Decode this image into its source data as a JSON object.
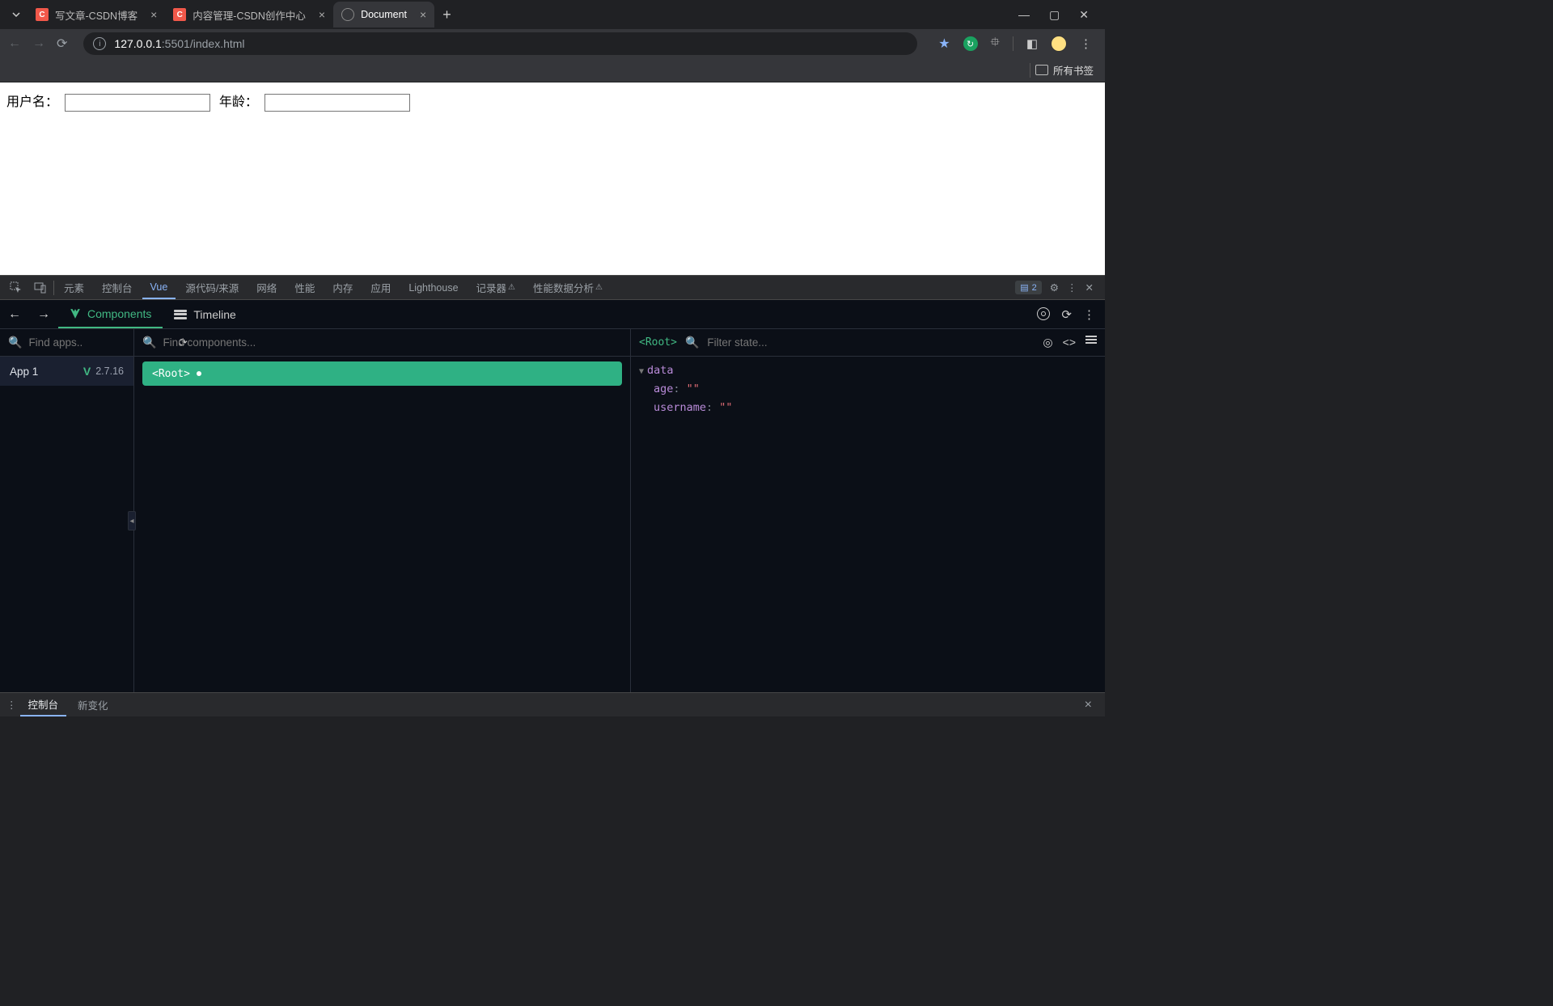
{
  "browser": {
    "tabs": [
      {
        "title": "写文章-CSDN博客",
        "favicon": "C",
        "active": false
      },
      {
        "title": "内容管理-CSDN创作中心",
        "favicon": "C",
        "active": false
      },
      {
        "title": "Document",
        "favicon": "globe",
        "active": true
      }
    ],
    "url_host": "127.0.0.1",
    "url_port_path": ":5501/index.html",
    "bookmarks_label": "所有书签"
  },
  "page": {
    "username_label": "用户名：",
    "username_value": "",
    "age_label": "年龄：",
    "age_value": ""
  },
  "devtools": {
    "tabs": [
      "元素",
      "控制台",
      "Vue",
      "源代码/来源",
      "网络",
      "性能",
      "内存",
      "应用",
      "Lighthouse",
      "记录器",
      "性能数据分析"
    ],
    "active_tab": "Vue",
    "msg_count": "2"
  },
  "vue": {
    "subtabs": {
      "components": "Components",
      "timeline": "Timeline"
    },
    "apps_search_placeholder": "Find apps..",
    "tree_search_placeholder": "Find components...",
    "state_search_placeholder": "Filter state...",
    "app_name": "App 1",
    "vue_version": "2.7.16",
    "root_label": "<Root>",
    "selected_component": "<Root>",
    "state_group": "data",
    "state": {
      "age_key": "age",
      "age_val": "\"\"",
      "username_key": "username",
      "username_val": "\"\""
    }
  },
  "drawer": {
    "tabs": [
      "控制台",
      "新变化"
    ],
    "active": "控制台"
  }
}
